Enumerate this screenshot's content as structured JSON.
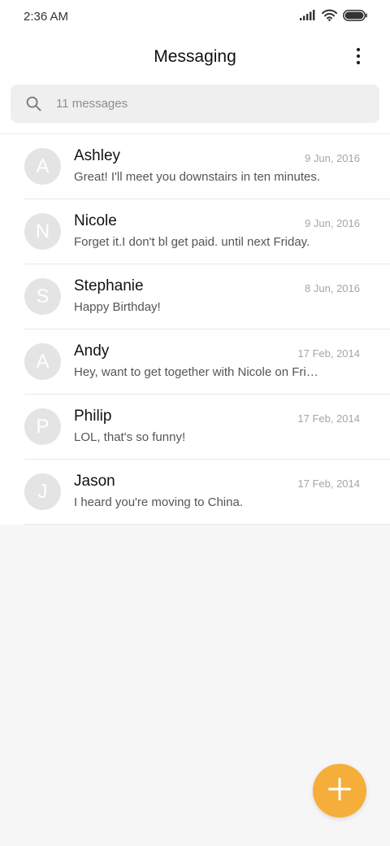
{
  "status_bar": {
    "time": "2:36 AM"
  },
  "header": {
    "title": "Messaging"
  },
  "search": {
    "placeholder": "11 messages"
  },
  "messages": [
    {
      "initial": "A",
      "name": "Ashley",
      "date": "9 Jun, 2016",
      "preview": "Great! I'll meet you downstairs in ten minutes."
    },
    {
      "initial": "N",
      "name": "Nicole",
      "date": "9 Jun, 2016",
      "preview": "Forget it.I don't bl get paid. until next Friday."
    },
    {
      "initial": "S",
      "name": "Stephanie",
      "date": "8 Jun, 2016",
      "preview": "Happy Birthday!"
    },
    {
      "initial": "A",
      "name": "Andy",
      "date": "17 Feb, 2014",
      "preview": "Hey, want to get together with Nicole on Friday?"
    },
    {
      "initial": "P",
      "name": "Philip",
      "date": "17 Feb, 2014",
      "preview": "LOL, that's so funny!"
    },
    {
      "initial": "J",
      "name": "Jason",
      "date": "17 Feb, 2014",
      "preview": "I heard you're moving to China."
    }
  ],
  "icons": {
    "signal": "signal-icon",
    "wifi": "wifi-icon",
    "battery": "battery-icon",
    "more": "more-vertical-icon",
    "search": "search-icon",
    "compose": "plus-icon"
  },
  "colors": {
    "accent": "#f6ae3b",
    "avatar_bg": "#e4e4e4",
    "page_bg": "#f6f6f6"
  }
}
